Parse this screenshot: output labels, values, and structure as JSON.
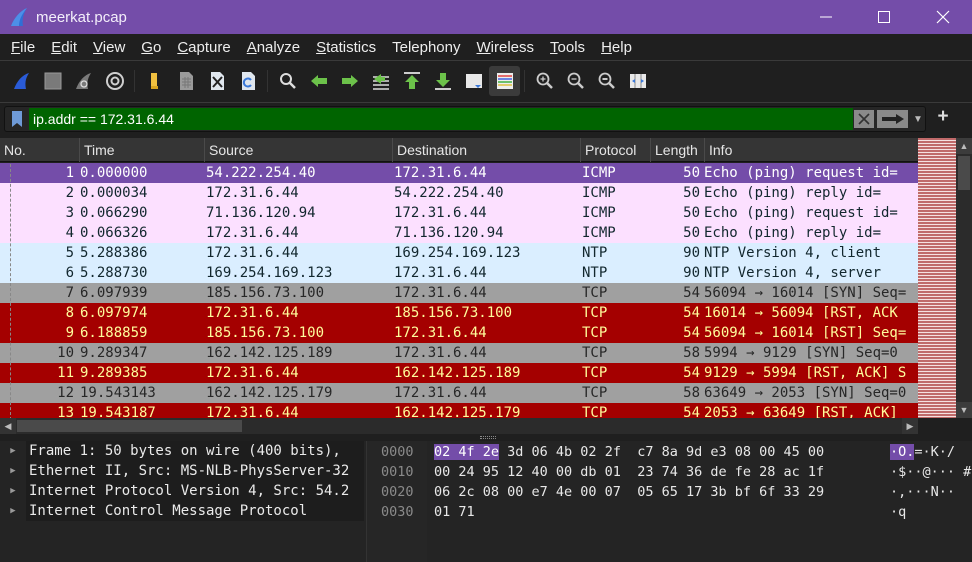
{
  "window": {
    "title": "meerkat.pcap",
    "controls": {
      "minimize": "—",
      "maximize": "☐",
      "close": "✕"
    }
  },
  "menu": [
    {
      "label": "File",
      "mnemonic": "F",
      "rest": "ile"
    },
    {
      "label": "Edit",
      "mnemonic": "E",
      "rest": "dit"
    },
    {
      "label": "View",
      "mnemonic": "V",
      "rest": "iew"
    },
    {
      "label": "Go",
      "mnemonic": "G",
      "rest": "o"
    },
    {
      "label": "Capture",
      "mnemonic": "C",
      "rest": "apture"
    },
    {
      "label": "Analyze",
      "mnemonic": "A",
      "rest": "nalyze"
    },
    {
      "label": "Statistics",
      "mnemonic": "S",
      "rest": "tatistics"
    },
    {
      "label": "Telephony",
      "mnemonic": "",
      "rest": "Telephony"
    },
    {
      "label": "Wireless",
      "mnemonic": "W",
      "rest": "ireless"
    },
    {
      "label": "Tools",
      "mnemonic": "T",
      "rest": "ools"
    },
    {
      "label": "Help",
      "mnemonic": "H",
      "rest": "elp"
    }
  ],
  "toolbar": [
    "start-capture-icon",
    "stop-capture-icon",
    "restart-capture-icon",
    "capture-options-icon",
    "open-file-icon",
    "save-file-icon",
    "close-file-icon",
    "reload-file-icon",
    "find-packet-icon",
    "go-back-icon",
    "go-forward-icon",
    "go-to-packet-icon",
    "first-packet-icon",
    "last-packet-icon",
    "autoscroll-icon",
    "colorize-icon",
    "zoom-in-icon",
    "zoom-out-icon",
    "normal-size-icon",
    "resize-columns-icon"
  ],
  "filter": {
    "value": "ip.addr == 172.31.6.44",
    "bg_color": "#006400"
  },
  "packet_list": {
    "columns": [
      "No.",
      "Time",
      "Source",
      "Destination",
      "Protocol",
      "Length",
      "Info"
    ],
    "rows": [
      {
        "no": "1",
        "time": "0.000000",
        "src": "54.222.254.40",
        "dst": "172.31.6.44",
        "proto": "ICMP",
        "len": "50",
        "info": "Echo (ping) request  id=",
        "bg": "#744da9",
        "fg": "#ffffff"
      },
      {
        "no": "2",
        "time": "0.000034",
        "src": "172.31.6.44",
        "dst": "54.222.254.40",
        "proto": "ICMP",
        "len": "50",
        "info": "Echo (ping) reply    id=",
        "bg": "#fce0ff",
        "fg": "#12272e"
      },
      {
        "no": "3",
        "time": "0.066290",
        "src": "71.136.120.94",
        "dst": "172.31.6.44",
        "proto": "ICMP",
        "len": "50",
        "info": "Echo (ping) request  id=",
        "bg": "#fce0ff",
        "fg": "#12272e"
      },
      {
        "no": "4",
        "time": "0.066326",
        "src": "172.31.6.44",
        "dst": "71.136.120.94",
        "proto": "ICMP",
        "len": "50",
        "info": "Echo (ping) reply    id=",
        "bg": "#fce0ff",
        "fg": "#12272e"
      },
      {
        "no": "5",
        "time": "5.288386",
        "src": "172.31.6.44",
        "dst": "169.254.169.123",
        "proto": "NTP",
        "len": "90",
        "info": "NTP Version 4, client",
        "bg": "#daeeff",
        "fg": "#12272e"
      },
      {
        "no": "6",
        "time": "5.288730",
        "src": "169.254.169.123",
        "dst": "172.31.6.44",
        "proto": "NTP",
        "len": "90",
        "info": "NTP Version 4, server",
        "bg": "#daeeff",
        "fg": "#12272e"
      },
      {
        "no": "7",
        "time": "6.097939",
        "src": "185.156.73.100",
        "dst": "172.31.6.44",
        "proto": "TCP",
        "len": "54",
        "info": "56094 → 16014 [SYN] Seq=",
        "bg": "#a0a0a0",
        "fg": "#272727"
      },
      {
        "no": "8",
        "time": "6.097974",
        "src": "172.31.6.44",
        "dst": "185.156.73.100",
        "proto": "TCP",
        "len": "54",
        "info": "16014 → 56094 [RST, ACK",
        "bg": "#a40000",
        "fg": "#fffc9c"
      },
      {
        "no": "9",
        "time": "6.188859",
        "src": "185.156.73.100",
        "dst": "172.31.6.44",
        "proto": "TCP",
        "len": "54",
        "info": "56094 → 16014 [RST] Seq=",
        "bg": "#a40000",
        "fg": "#fffc9c"
      },
      {
        "no": "10",
        "time": "9.289347",
        "src": "162.142.125.189",
        "dst": "172.31.6.44",
        "proto": "TCP",
        "len": "58",
        "info": "5994 → 9129 [SYN] Seq=0",
        "bg": "#a0a0a0",
        "fg": "#272727"
      },
      {
        "no": "11",
        "time": "9.289385",
        "src": "172.31.6.44",
        "dst": "162.142.125.189",
        "proto": "TCP",
        "len": "54",
        "info": "9129 → 5994 [RST, ACK] S",
        "bg": "#a40000",
        "fg": "#fffc9c"
      },
      {
        "no": "12",
        "time": "19.543143",
        "src": "162.142.125.179",
        "dst": "172.31.6.44",
        "proto": "TCP",
        "len": "58",
        "info": "63649 → 2053 [SYN] Seq=0",
        "bg": "#a0a0a0",
        "fg": "#272727"
      },
      {
        "no": "13",
        "time": "19.543187",
        "src": "172.31.6.44",
        "dst": "162.142.125.179",
        "proto": "TCP",
        "len": "54",
        "info": "2053 → 63649 [RST, ACK]",
        "bg": "#a40000",
        "fg": "#fffc9c"
      }
    ]
  },
  "details": [
    "Frame 1: 50 bytes on wire (400 bits),",
    "Ethernet II, Src: MS-NLB-PhysServer-32",
    "Internet Protocol Version 4, Src: 54.2",
    "Internet Control Message Protocol"
  ],
  "bytes": [
    {
      "offset": "0000",
      "hl_hex": "02 4f 2e",
      "hex": " 3d 06 4b 02 2f  c7 8a 9d e3 08 00 45 00",
      "hl_ascii": "·O.",
      "ascii": "=·K·/"
    },
    {
      "offset": "0010",
      "hl_hex": "",
      "hex": "00 24 95 12 40 00 db 01  23 74 36 de fe 28 ac 1f",
      "hl_ascii": "",
      "ascii": "·$··@··· #"
    },
    {
      "offset": "0020",
      "hl_hex": "",
      "hex": "06 2c 08 00 e7 4e 00 07  05 65 17 3b bf 6f 33 29",
      "hl_ascii": "",
      "ascii": "·,···N··"
    },
    {
      "offset": "0030",
      "hl_hex": "",
      "hex": "01 71",
      "hl_ascii": "",
      "ascii": "·q"
    }
  ]
}
